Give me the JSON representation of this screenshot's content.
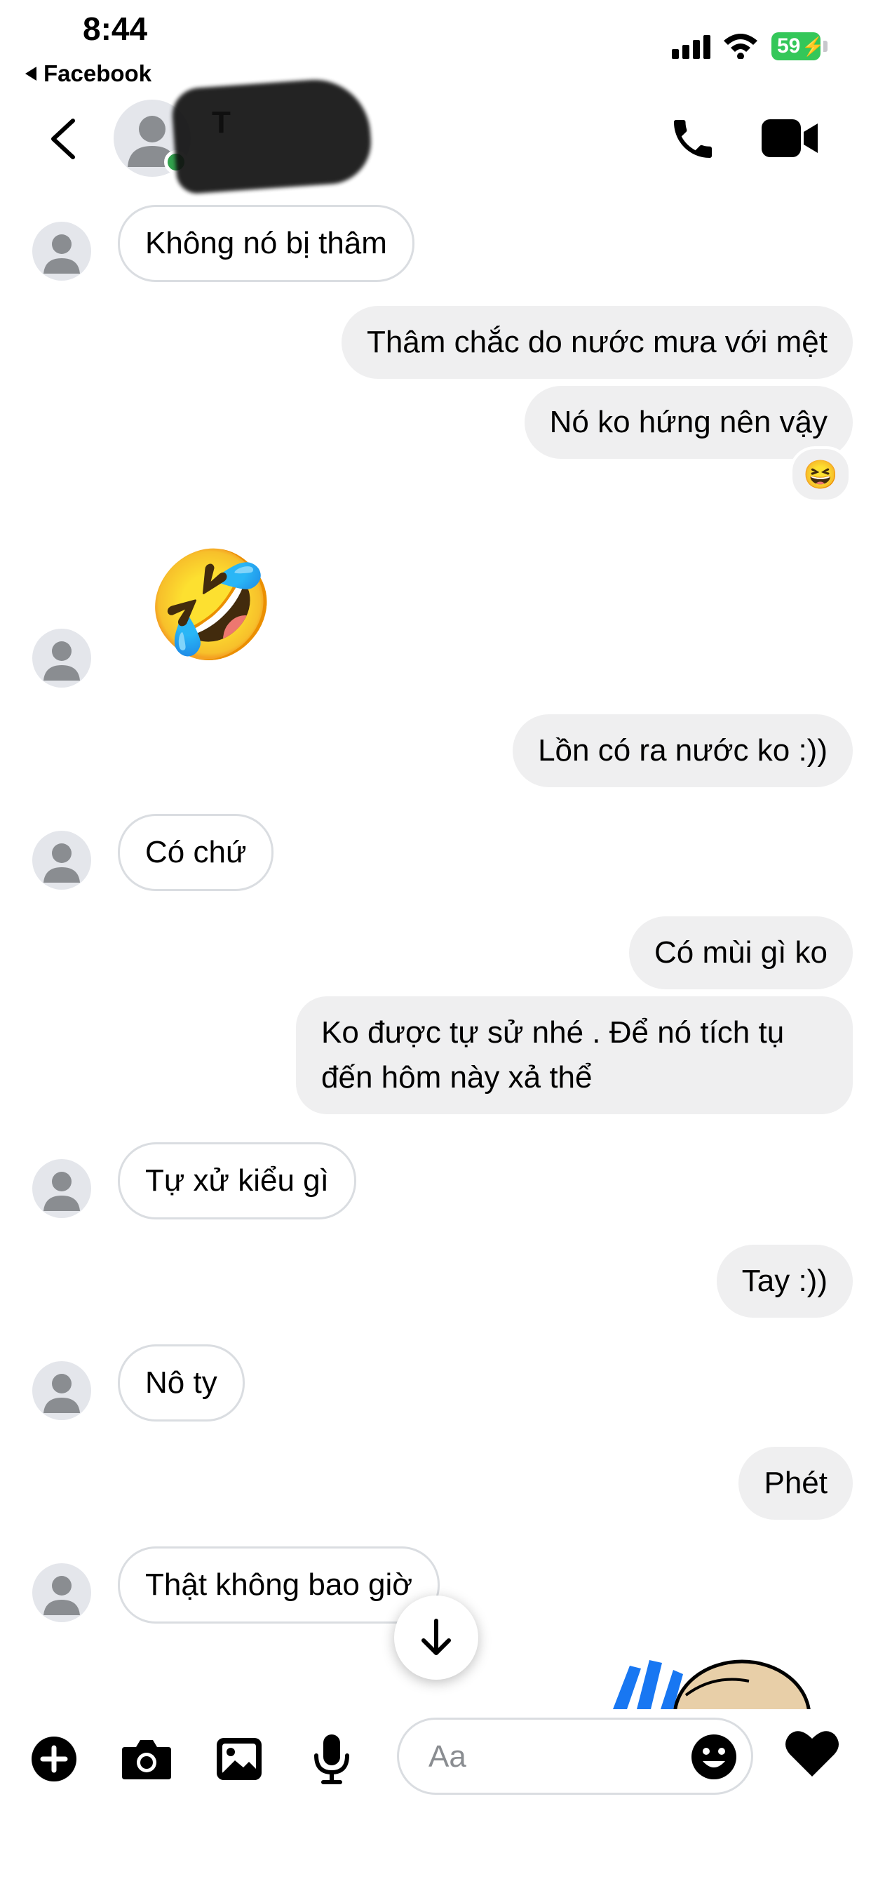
{
  "status_bar": {
    "time": "8:44",
    "back_app": "Facebook",
    "battery": "59"
  },
  "header": {
    "contact_name": "T",
    "contact_sub": "",
    "icons": [
      "back-chevron-icon",
      "phone-icon",
      "video-camera-icon"
    ]
  },
  "messages": [
    {
      "side": "incoming",
      "text": "Không nó bị thâm"
    },
    {
      "side": "outgoing",
      "text": "Thâm chắc do nước mưa với mệt"
    },
    {
      "side": "outgoing",
      "text": "Nó ko hứng nên vậy",
      "reaction": "😆"
    },
    {
      "side": "incoming",
      "emoji": "🤣"
    },
    {
      "side": "outgoing",
      "text": "Lồn có ra nước ko :))"
    },
    {
      "side": "incoming",
      "text": "Có chứ"
    },
    {
      "side": "outgoing",
      "text": "Có mùi gì ko"
    },
    {
      "side": "outgoing",
      "text": "Ko được tự sử nhé . Để nó tích tụ đến hôm này xả thể"
    },
    {
      "side": "incoming",
      "text": "Tự xử kiểu gì"
    },
    {
      "side": "outgoing",
      "text": "Tay :))"
    },
    {
      "side": "incoming",
      "text": "Nô ty"
    },
    {
      "side": "outgoing",
      "text": "Phét"
    },
    {
      "side": "incoming",
      "text": "Thật không bao giờ"
    }
  ],
  "composer": {
    "placeholder": "Aa",
    "icons": [
      "plus-icon",
      "camera-icon",
      "gallery-icon",
      "microphone-icon",
      "emoji-icon",
      "heart-icon"
    ]
  },
  "colors": {
    "outgoing_bubble": "#efeff0",
    "incoming_border": "#dadde1",
    "online": "#31a24c",
    "battery": "#34c759"
  }
}
